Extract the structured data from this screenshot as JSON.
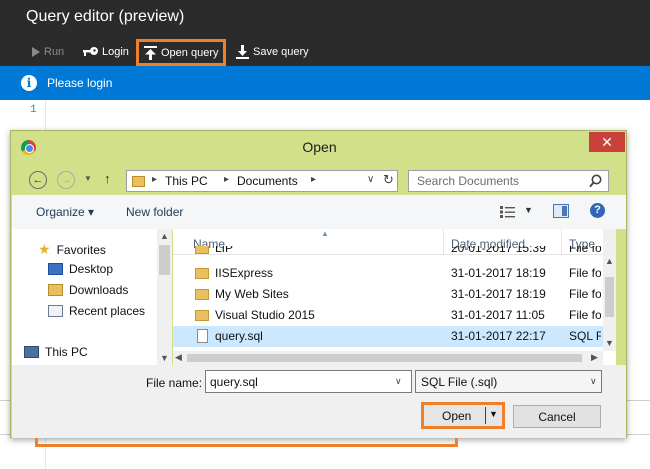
{
  "app": {
    "title": "Query editor (preview)",
    "toolbar": {
      "run_label": "Run",
      "login_label": "Login",
      "open_label": "Open query",
      "save_label": "Save query"
    },
    "notice": {
      "text": "Please login"
    },
    "editor": {
      "line_number": "1"
    }
  },
  "dialog": {
    "title": "Open",
    "close_glyph": "✕",
    "address": {
      "crumbs": [
        "This PC",
        "Documents"
      ],
      "separator": "▸"
    },
    "search": {
      "placeholder": "Search Documents"
    },
    "commands": {
      "organize": "Organize ▾",
      "new_folder": "New folder"
    },
    "nav": {
      "favorites": "Favorites",
      "desktop": "Desktop",
      "downloads": "Downloads",
      "recent_places": "Recent places",
      "this_pc": "This PC"
    },
    "columns": {
      "name": "Name",
      "date": "Date modified",
      "type": "Type"
    },
    "files": [
      {
        "name": "LIP",
        "date": "20-01-2017 15:39",
        "type": "File folder",
        "kind": "folder"
      },
      {
        "name": "IISExpress",
        "date": "31-01-2017 18:19",
        "type": "File folder",
        "kind": "folder"
      },
      {
        "name": "My Web Sites",
        "date": "31-01-2017 18:19",
        "type": "File folder",
        "kind": "folder"
      },
      {
        "name": "Visual Studio 2015",
        "date": "31-01-2017 11:05",
        "type": "File folder",
        "kind": "folder"
      },
      {
        "name": "query.sql",
        "date": "31-01-2017 22:17",
        "type": "SQL File",
        "kind": "file",
        "selected": true
      }
    ],
    "filename": {
      "label": "File name:",
      "value": "query.sql"
    },
    "filetype": {
      "value": "SQL File (.sql)"
    },
    "buttons": {
      "open": "Open",
      "cancel": "Cancel"
    }
  },
  "colors": {
    "dark_chrome": "#2b2b2b",
    "notice_blue": "#0079d6",
    "highlight_orange": "#f07f2a",
    "dialog_frame": "#d3e08a",
    "selection": "#cce8ff"
  }
}
